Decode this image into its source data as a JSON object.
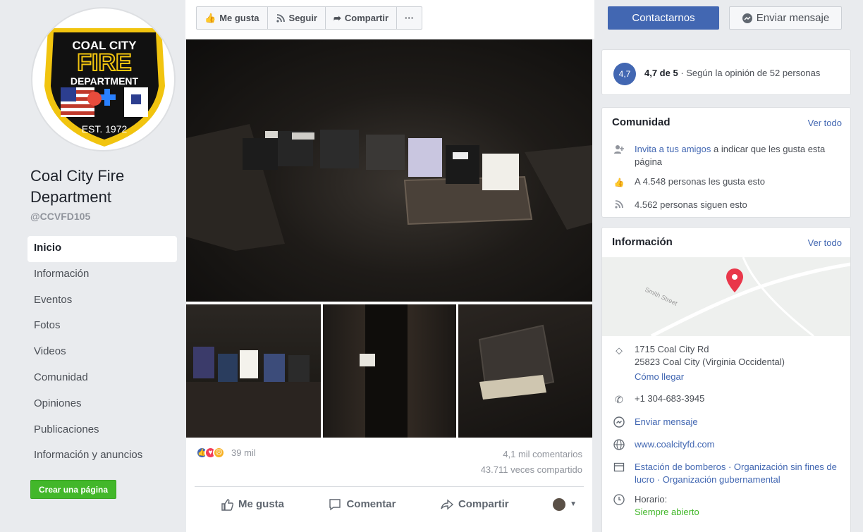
{
  "page": {
    "name": "Coal City Fire Department",
    "handle": "@CCVFD105",
    "logo": {
      "top_text": "COAL CITY",
      "main_text": "FIRE",
      "sub_text": "DEPARTMENT",
      "est_text": "EST. 1972"
    }
  },
  "sidebar": {
    "items": [
      {
        "label": "Inicio",
        "active": true
      },
      {
        "label": "Información"
      },
      {
        "label": "Eventos"
      },
      {
        "label": "Fotos"
      },
      {
        "label": "Videos"
      },
      {
        "label": "Comunidad"
      },
      {
        "label": "Opiniones"
      },
      {
        "label": "Publicaciones"
      },
      {
        "label": "Información y anuncios"
      }
    ],
    "create_page_label": "Crear una página"
  },
  "toolbar": {
    "like_label": "Me gusta",
    "follow_label": "Seguir",
    "share_label": "Compartir",
    "more_label": "···",
    "contact_label": "Contactarnos",
    "message_label": "Enviar mensaje"
  },
  "post": {
    "reactions_count": "39 mil",
    "comments": "4,1 mil comentarios",
    "shares": "43.711 veces compartido",
    "actions": {
      "like": "Me gusta",
      "comment": "Comentar",
      "share": "Compartir"
    }
  },
  "rating": {
    "score": "4,7",
    "summary_bold": "4,7 de 5",
    "summary_rest": " · Según la opinión de 52 personas"
  },
  "community": {
    "title": "Comunidad",
    "see_all": "Ver todo",
    "invite_link": "Invita a tus amigos",
    "invite_rest": " a indicar que les gusta esta página",
    "likes": "A 4.548 personas les gusta esto",
    "follows": "4.562 personas siguen esto"
  },
  "info": {
    "title": "Información",
    "see_all": "Ver todo",
    "map_street": "Smith Street",
    "address_line1": "1715 Coal City Rd",
    "address_line2": "25823 Coal City (Virginia Occidental)",
    "directions": "Cómo llegar",
    "phone": "+1 304-683-3945",
    "send_message": "Enviar mensaje",
    "website": "www.coalcityfd.com",
    "categories": "Estación de bomberos · Organización sin fines de lucro · Organización gubernamental",
    "hours_label": "Horario:",
    "hours_value": "Siempre abierto"
  },
  "colors": {
    "brand_blue": "#4267b2",
    "green": "#42b72a",
    "background": "#e9ebee"
  }
}
